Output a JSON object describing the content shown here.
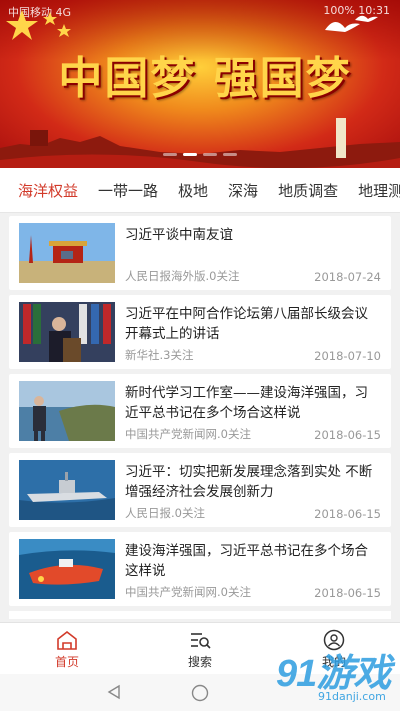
{
  "status": {
    "left": "中国移动 4G",
    "right": "100% 10:31"
  },
  "banner": {
    "title": "中国梦 强国梦"
  },
  "tabs": [
    "海洋权益",
    "一带一路",
    "极地",
    "深海",
    "地质调查",
    "地理测"
  ],
  "colors": {
    "accent": "#d23a2a",
    "banner_red": "#c81e14",
    "banner_gold": "#ffd54a"
  },
  "articles": [
    {
      "title": "习近平谈中南友谊",
      "source": "人民日报海外版.0关注",
      "date": "2018-07-24",
      "thumb": "tiananmen"
    },
    {
      "title": "习近平在中阿合作论坛第八届部长级会议开幕式上的讲话",
      "source": "新华社.3关注",
      "date": "2018-07-10",
      "thumb": "podium"
    },
    {
      "title": "新时代学习工作室——建设海洋强国，习近平总书记在多个场合这样说",
      "source": "中国共产党新闻网.0关注",
      "date": "2018-06-15",
      "thumb": "coast"
    },
    {
      "title": "习近平：切实把新发展理念落到实处 不断增强经济社会发展创新力",
      "source": "人民日报.0关注",
      "date": "2018-06-15",
      "thumb": "ship"
    },
    {
      "title": "建设海洋强国，习近平总书记在多个场合这样说",
      "source": "中国共产党新闻网.0关注",
      "date": "2018-06-15",
      "thumb": "submersible"
    }
  ],
  "nav": {
    "home": "首页",
    "search": "搜索",
    "mine": "我的"
  },
  "watermark": {
    "big": "91游戏",
    "small": "91danji.com"
  }
}
